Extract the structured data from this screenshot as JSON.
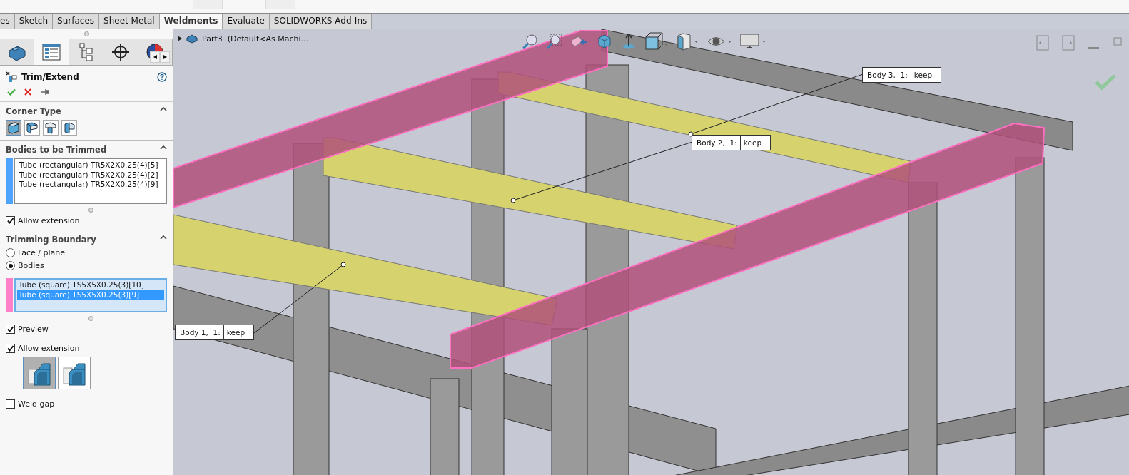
{
  "ribbon_tabs": [
    {
      "label": "es",
      "selected": false
    },
    {
      "label": "Sketch",
      "selected": false
    },
    {
      "label": "Surfaces",
      "selected": false
    },
    {
      "label": "Sheet Metal",
      "selected": false
    },
    {
      "label": "Weldments",
      "selected": true
    },
    {
      "label": "Evaluate",
      "selected": false
    },
    {
      "label": "SOLIDWORKS Add-Ins",
      "selected": false
    }
  ],
  "panel_tabs": [
    {
      "kind": "part",
      "selected": false
    },
    {
      "kind": "properties",
      "selected": true
    },
    {
      "kind": "configurations",
      "selected": false
    },
    {
      "kind": "dimxpert",
      "selected": false
    },
    {
      "kind": "appearance",
      "selected": false
    }
  ],
  "feature": {
    "title": "Trim/Extend"
  },
  "corner_type": {
    "title": "Corner Type",
    "options": [
      {
        "selected": true
      },
      {
        "selected": false
      },
      {
        "selected": false
      },
      {
        "selected": false
      }
    ]
  },
  "bodies_to_trim": {
    "title": "Bodies to be Trimmed",
    "color": "#4da3ff",
    "items": [
      "Tube (rectangular) TR5X2X0.25(4)[5]",
      "Tube (rectangular) TR5X2X0.25(4)[2]",
      "Tube (rectangular) TR5X2X0.25(4)[9]"
    ],
    "allow_extension": {
      "label": "Allow extension",
      "checked": true
    }
  },
  "trimming_boundary": {
    "title": "Trimming Boundary",
    "options": [
      {
        "label": "Face / plane",
        "selected": false
      },
      {
        "label": "Bodies",
        "selected": true
      }
    ],
    "color": "#ff7fc8",
    "items": [
      {
        "text": "Tube (square) TS5X5X0.25(3)[10]",
        "selected": false
      },
      {
        "text": "Tube (square) TS5X5X0.25(3)[9]",
        "selected": true
      }
    ],
    "preview": {
      "label": "Preview",
      "checked": true
    },
    "allow_extension": {
      "label": "Allow extension",
      "checked": true
    },
    "extension_styles": [
      {
        "selected": true
      },
      {
        "selected": false
      }
    ],
    "weld_gap": {
      "label": "Weld gap",
      "checked": false
    }
  },
  "viewport": {
    "tree_item": "Part3  (Default<As Machi...",
    "callouts": [
      {
        "label": "Body 3,  1:",
        "value": "keep"
      },
      {
        "label": "Body 2,  1:",
        "value": "keep"
      },
      {
        "label": "Body 1,  1:",
        "value": "keep"
      }
    ]
  }
}
